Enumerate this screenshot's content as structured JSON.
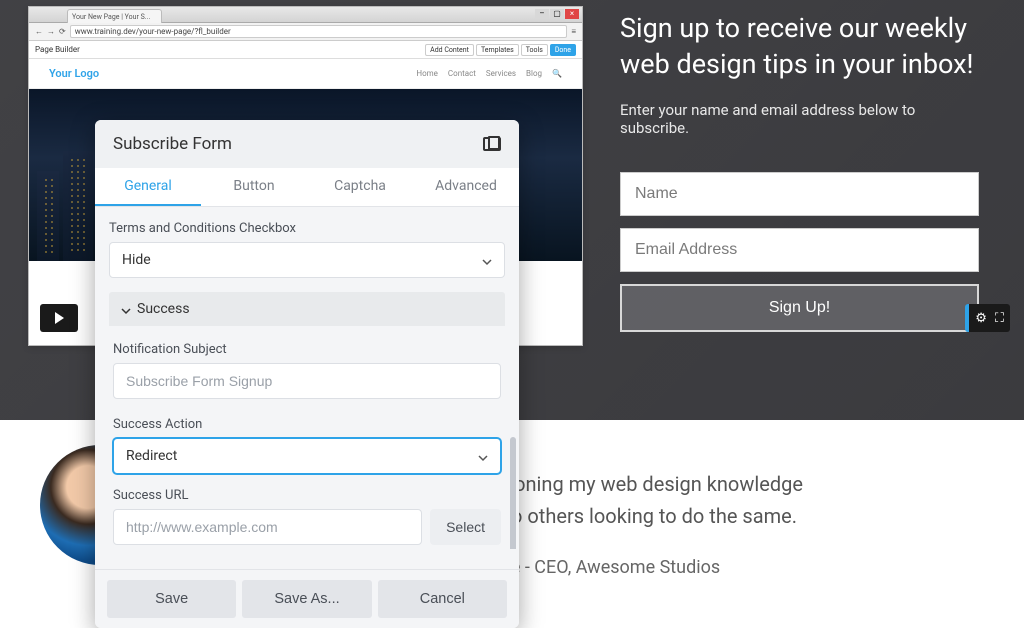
{
  "hero": {
    "title": "Sign up to receive our weekly web design tips in your inbox!",
    "subtitle": "Enter your name and email address below to subscribe.",
    "name_placeholder": "Name",
    "email_placeholder": "Email Address",
    "button_label": "Sign Up!"
  },
  "testimonial": {
    "line1": "hen it comes to honing my web design knowledge",
    "line2": "s I recommend to others looking to do the same.",
    "author": "Lisa Lane - CEO, Awesome Studios"
  },
  "browser": {
    "tab_title": "Your New Page | Your S...",
    "url": "www.training.dev/your-new-page/?fl_builder",
    "page_builder_label": "Page Builder",
    "actions": {
      "add": "Add Content",
      "templates": "Templates",
      "tools": "Tools",
      "done": "Done"
    },
    "site_logo": "Your Logo",
    "nav": [
      "Home",
      "Contact",
      "Services",
      "Blog"
    ]
  },
  "panel": {
    "title": "Subscribe Form",
    "tabs": [
      "General",
      "Button",
      "Captcha",
      "Advanced"
    ],
    "active_tab": "General",
    "terms_label": "Terms and Conditions Checkbox",
    "terms_value": "Hide",
    "success_section": "Success",
    "notify_label": "Notification Subject",
    "notify_placeholder": "Subscribe Form Signup",
    "action_label": "Success Action",
    "action_value": "Redirect",
    "url_label": "Success URL",
    "url_placeholder": "http://www.example.com",
    "select_btn": "Select",
    "footer": {
      "save": "Save",
      "save_as": "Save As...",
      "cancel": "Cancel"
    }
  }
}
